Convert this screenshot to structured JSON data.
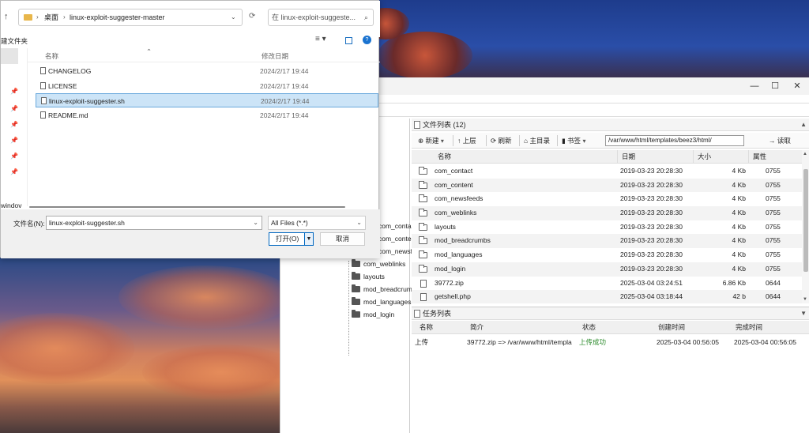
{
  "dialog": {
    "address": {
      "folder": "桌面",
      "current": "linux-exploit-suggester-master"
    },
    "search_placeholder": "在 linux-exploit-suggeste...",
    "new_folder_label": "建文件夹",
    "nav_tail_label": "windov",
    "columns": {
      "name": "名称",
      "date": "修改日期"
    },
    "files": [
      {
        "name": "CHANGELOG",
        "date": "2024/2/17 19:44"
      },
      {
        "name": "LICENSE",
        "date": "2024/2/17 19:44"
      },
      {
        "name": "linux-exploit-suggester.sh",
        "date": "2024/2/17 19:44",
        "selected": true
      },
      {
        "name": "README.md",
        "date": "2024/2/17 19:44"
      }
    ],
    "filename_label": "文件名(N):",
    "filename_value": "linux-exploit-suggester.sh",
    "filetype": "All Files (*.*)",
    "open_label": "打开(O)",
    "cancel_label": "取消"
  },
  "tree": {
    "items": [
      "com_contact",
      "com_content",
      "com_newsfeeds",
      "com_weblinks",
      "layouts",
      "mod_breadcrumbs",
      "mod_languages",
      "mod_login"
    ]
  },
  "filelist": {
    "title": "文件列表 (12)",
    "toolbar": {
      "new": "新建",
      "up": "上层",
      "refresh": "刷新",
      "home": "主目录",
      "bookmark": "书签",
      "read": "读取"
    },
    "path": "/var/www/html/templates/beez3/html/",
    "columns": {
      "name": "名称",
      "date": "日期",
      "size": "大小",
      "attr": "属性"
    },
    "rows": [
      {
        "name": "com_contact",
        "date": "2019-03-23 20:28:30",
        "size": "4 Kb",
        "attr": "0755",
        "type": "folder"
      },
      {
        "name": "com_content",
        "date": "2019-03-23 20:28:30",
        "size": "4 Kb",
        "attr": "0755",
        "type": "folder"
      },
      {
        "name": "com_newsfeeds",
        "date": "2019-03-23 20:28:30",
        "size": "4 Kb",
        "attr": "0755",
        "type": "folder"
      },
      {
        "name": "com_weblinks",
        "date": "2019-03-23 20:28:30",
        "size": "4 Kb",
        "attr": "0755",
        "type": "folder"
      },
      {
        "name": "layouts",
        "date": "2019-03-23 20:28:30",
        "size": "4 Kb",
        "attr": "0755",
        "type": "folder"
      },
      {
        "name": "mod_breadcrumbs",
        "date": "2019-03-23 20:28:30",
        "size": "4 Kb",
        "attr": "0755",
        "type": "folder"
      },
      {
        "name": "mod_languages",
        "date": "2019-03-23 20:28:30",
        "size": "4 Kb",
        "attr": "0755",
        "type": "folder"
      },
      {
        "name": "mod_login",
        "date": "2019-03-23 20:28:30",
        "size": "4 Kb",
        "attr": "0755",
        "type": "folder"
      },
      {
        "name": "39772.zip",
        "date": "2025-03-04 03:24:51",
        "size": "6.86 Kb",
        "attr": "0644",
        "type": "file"
      },
      {
        "name": "getshell.php",
        "date": "2025-03-04 03:18:44",
        "size": "42 b",
        "attr": "0644",
        "type": "file"
      }
    ]
  },
  "tasks": {
    "title": "任务列表",
    "columns": {
      "name": "名称",
      "desc": "简介",
      "status": "状态",
      "created": "创建时间",
      "finished": "完成时间"
    },
    "rows": [
      {
        "name": "上传",
        "desc": "39772.zip => /var/www/html/templa",
        "status": "上传成功",
        "created": "2025-03-04 00:56:05",
        "finished": "2025-03-04 00:56:05"
      }
    ]
  }
}
